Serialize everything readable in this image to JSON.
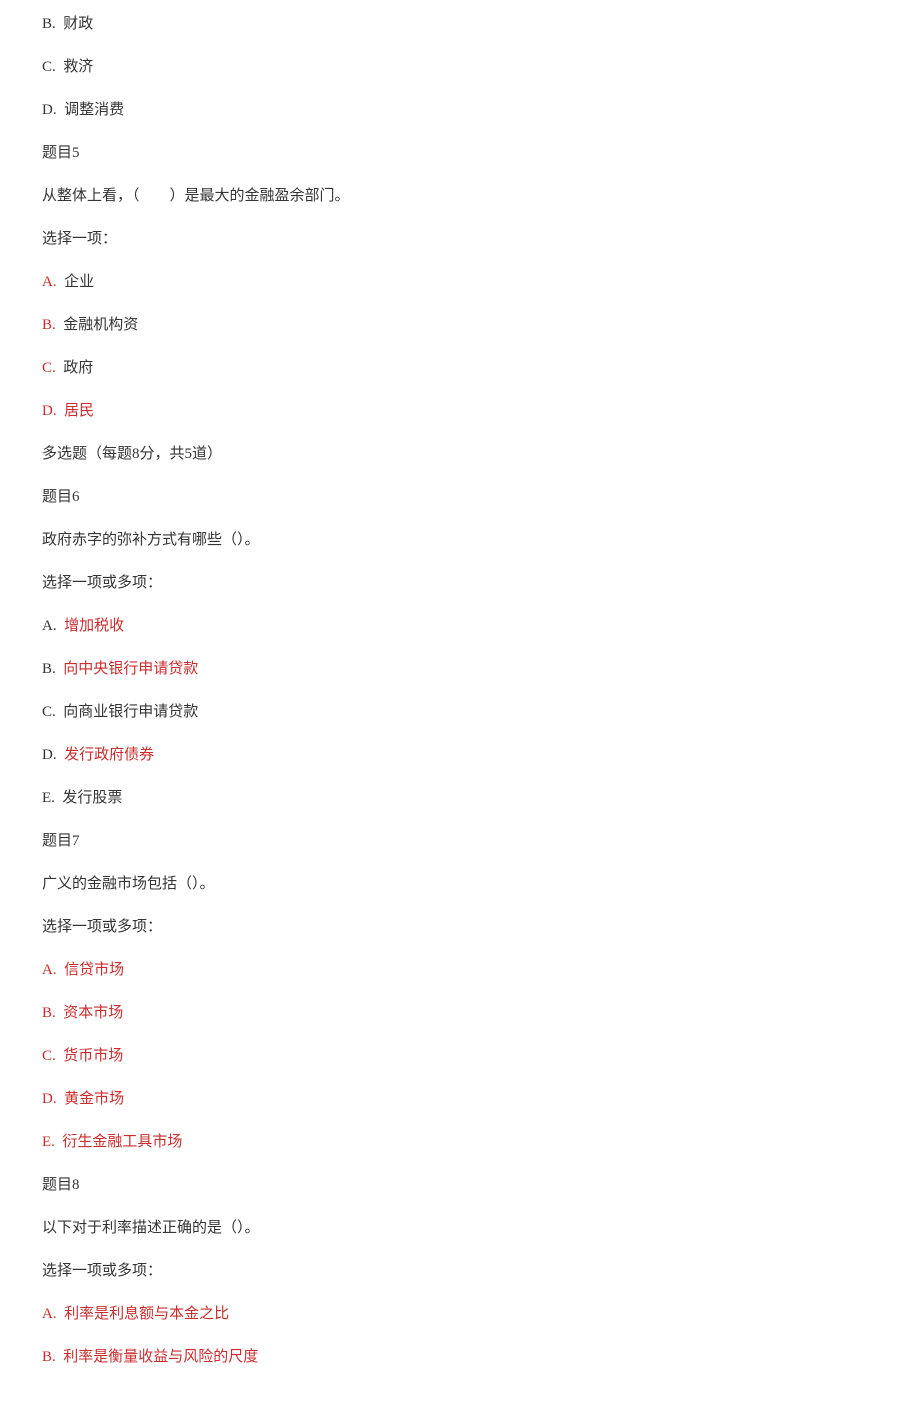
{
  "pre_options": [
    {
      "letter": "B.",
      "text": "财政",
      "red": false
    },
    {
      "letter": "C.",
      "text": "救济",
      "red": false
    },
    {
      "letter": "D.",
      "text": "调整消费",
      "red": false
    }
  ],
  "q5": {
    "title": "题目5",
    "stem": "从整体上看，（　　）是最大的金融盈余部门。",
    "prompt": "选择一项：",
    "options": [
      {
        "letter": "A.",
        "text": "企业",
        "letter_red": true,
        "text_red": false
      },
      {
        "letter": "B.",
        "text": "金融机构资",
        "letter_red": true,
        "text_red": false
      },
      {
        "letter": "C.",
        "text": "政府",
        "letter_red": true,
        "text_red": false
      },
      {
        "letter": "D.",
        "text": "居民",
        "letter_red": true,
        "text_red": true
      }
    ]
  },
  "section_multi": "多选题（每题8分，共5道）",
  "q6": {
    "title": "题目6",
    "stem": "政府赤字的弥补方式有哪些（）。",
    "prompt": "选择一项或多项：",
    "options": [
      {
        "letter": "A.",
        "text": "增加税收",
        "text_red": true
      },
      {
        "letter": "B.",
        "text": "向中央银行申请贷款",
        "text_red": true
      },
      {
        "letter": "C.",
        "text": "向商业银行申请贷款",
        "text_red": false
      },
      {
        "letter": "D.",
        "text": "发行政府债券",
        "text_red": true
      },
      {
        "letter": "E.",
        "text": "发行股票",
        "text_red": false
      }
    ]
  },
  "q7": {
    "title": "题目7",
    "stem": "广义的金融市场包括（）。",
    "prompt": "选择一项或多项：",
    "options": [
      {
        "letter": "A.",
        "text": "信贷市场",
        "letter_red": true,
        "text_red": true
      },
      {
        "letter": "B.",
        "text": "资本市场",
        "letter_red": true,
        "text_red": true
      },
      {
        "letter": "C.",
        "text": "货币市场",
        "letter_red": true,
        "text_red": true
      },
      {
        "letter": "D.",
        "text": "黄金市场",
        "letter_red": true,
        "text_red": true
      },
      {
        "letter": "E.",
        "text": "衍生金融工具市场",
        "letter_red": true,
        "text_red": true
      }
    ]
  },
  "q8": {
    "title": "题目8",
    "stem": "以下对于利率描述正确的是（）。",
    "prompt": "选择一项或多项：",
    "options": [
      {
        "letter": "A.",
        "text": "利率是利息额与本金之比",
        "letter_red": true,
        "text_red": true
      },
      {
        "letter": "B.",
        "text": "利率是衡量收益与风险的尺度",
        "letter_red": true,
        "text_red": true
      }
    ]
  }
}
